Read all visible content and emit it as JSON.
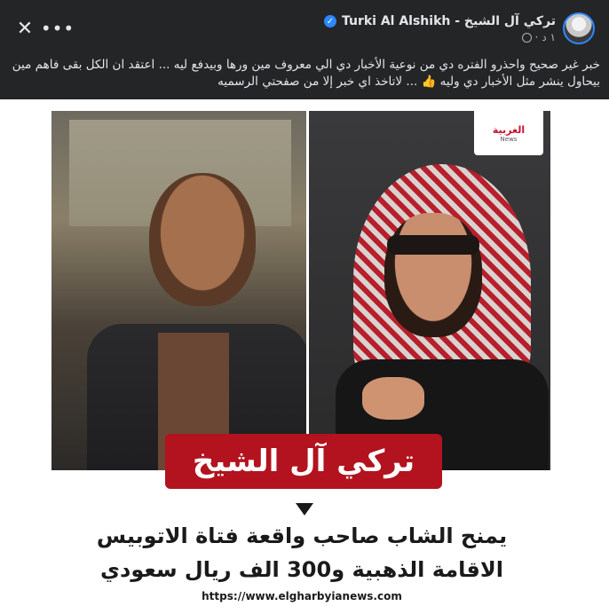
{
  "header": {
    "close_glyph": "✕",
    "more_glyph": "•••",
    "author_name": "تركي آل الشيخ - Turki Al Alshikh",
    "post_time": "١ د",
    "separator": "·",
    "verified_icon": "verified-badge-icon",
    "privacy_icon": "globe-icon",
    "avatar": "avatar"
  },
  "post": {
    "text": "خبر غير صحيح واحذرو الفتره دي من نوعية الأخبار دي الي معروف مين ورها وبيدفع ليه ... اعتقد ان الكل بقى فاهم مين بيحاول ينشر مثل الأخبار دي وليه 👍 ... لاتاخذ اي خبر إلا من صفحتي الرسميه"
  },
  "image": {
    "news_logo_word": "الغربية",
    "news_logo_sub": "News",
    "banner_title": "تركي آل الشيخ",
    "headline_line1": "يمنح الشاب صاحب واقعة فتاة الاتوبيس",
    "headline_line2": "الاقامة الذهبية و300 الف ريال سعودي",
    "source_url": "https://www.elgharbyianews.com",
    "banner_color": "#b2131e"
  }
}
